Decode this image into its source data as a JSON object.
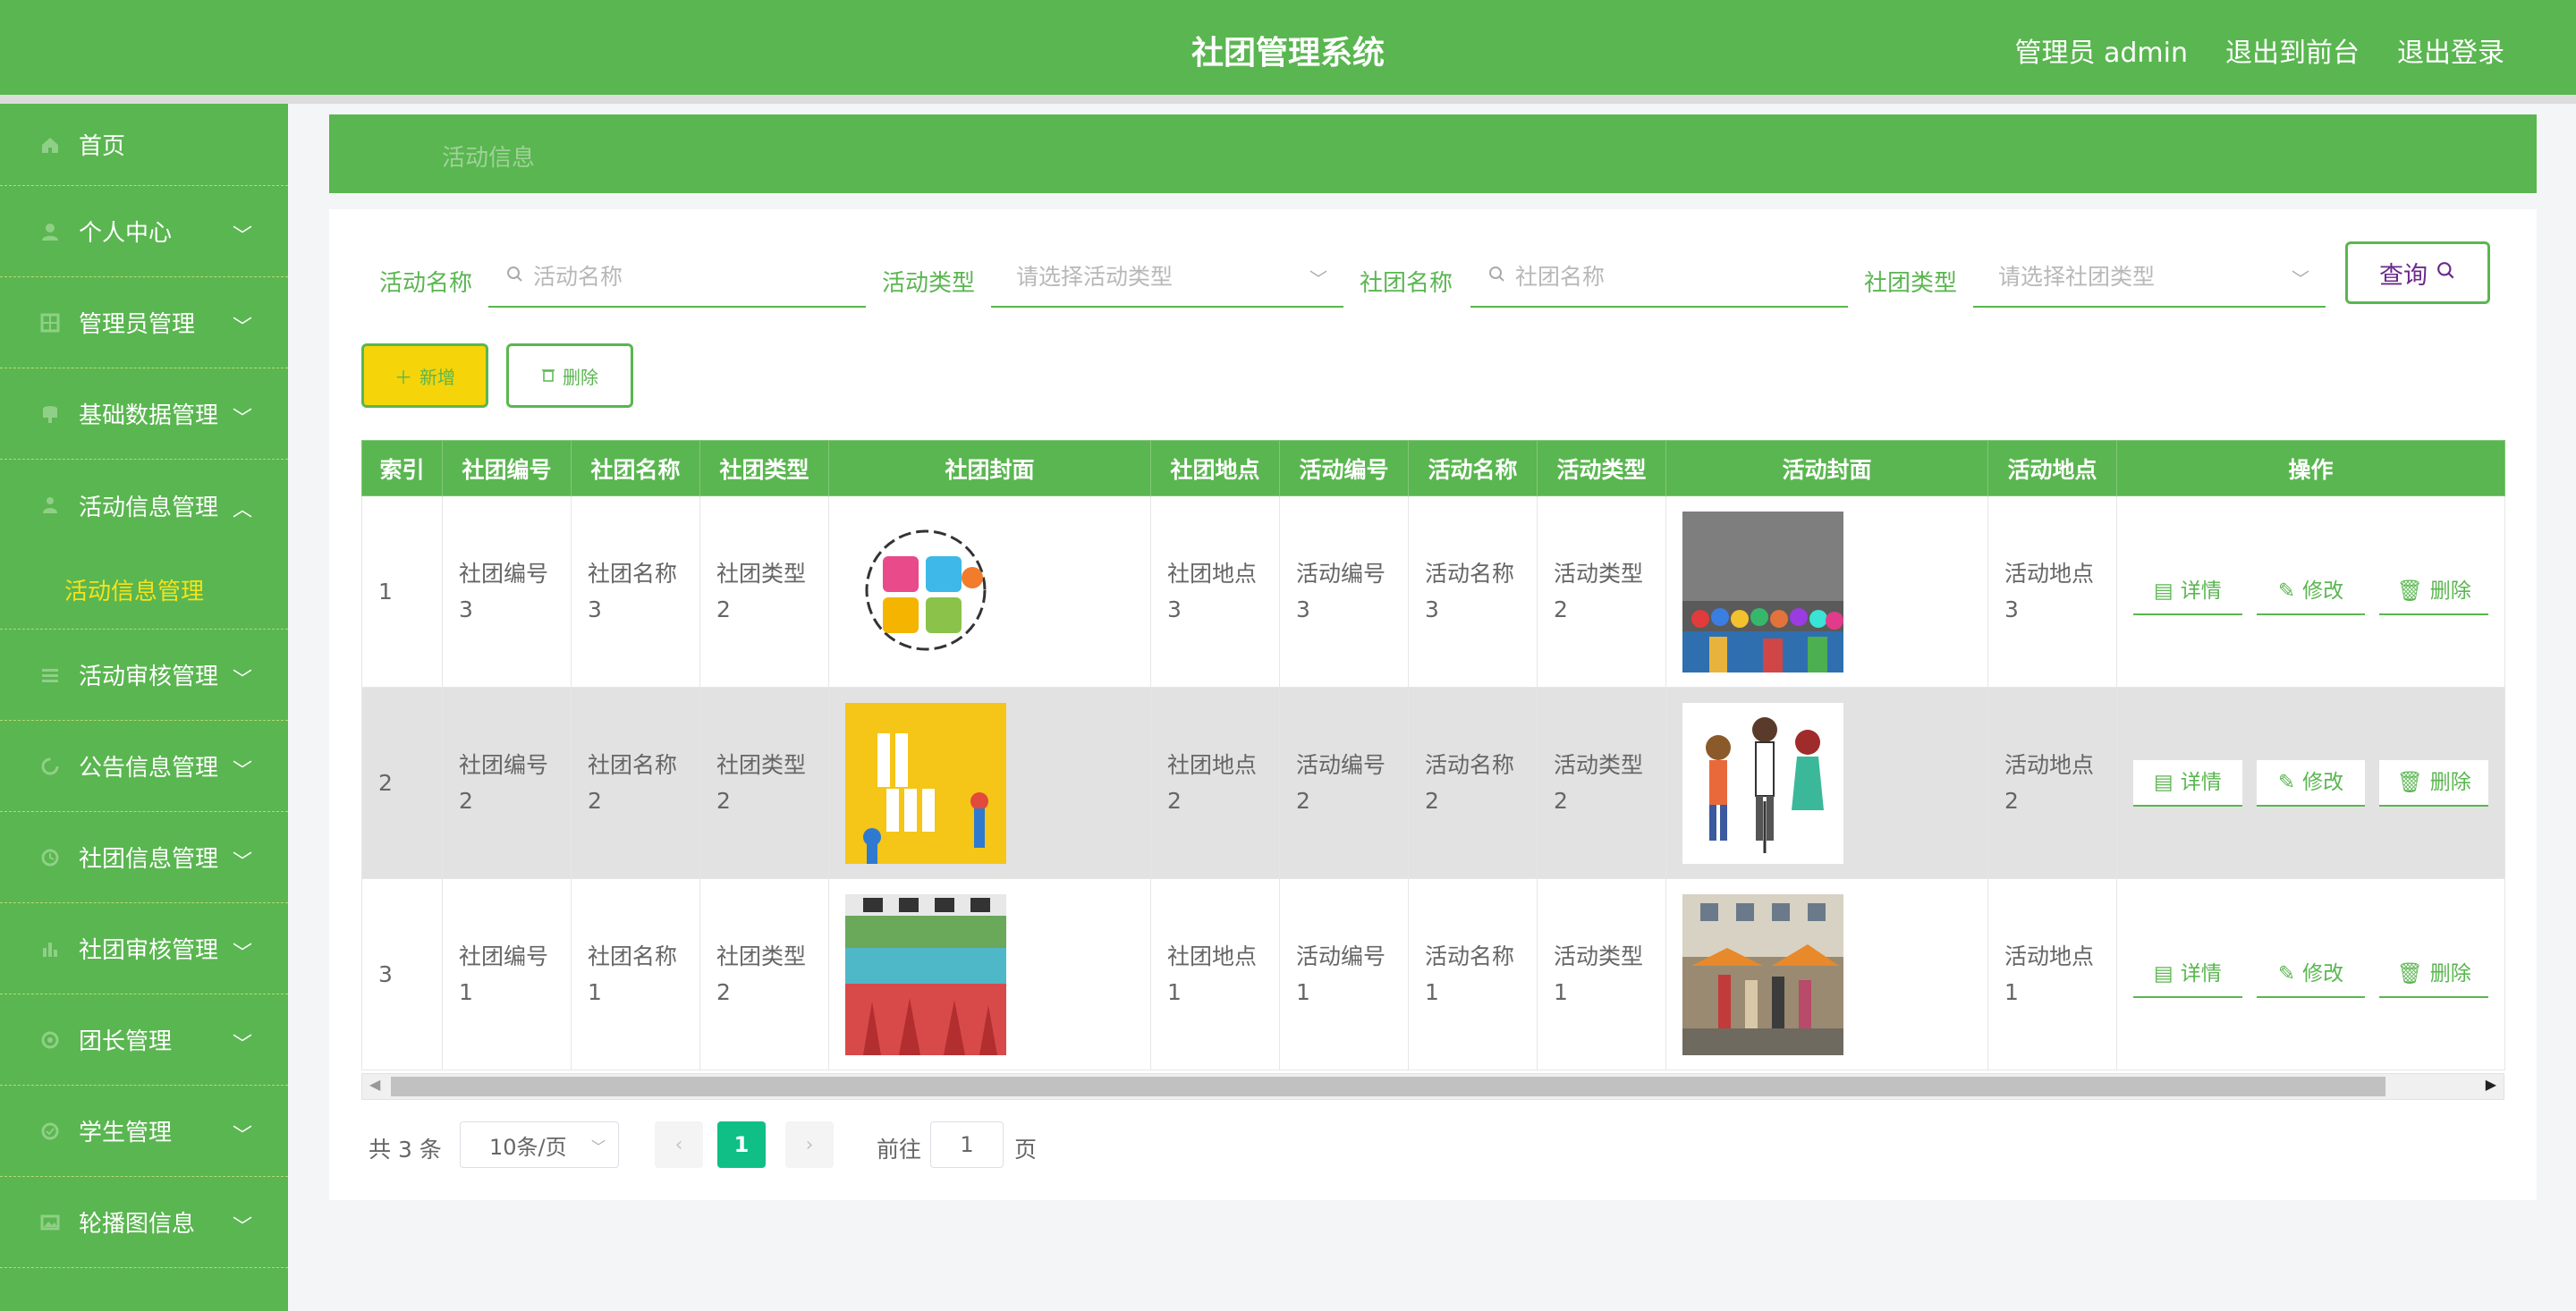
{
  "header": {
    "title": "社团管理系统",
    "admin_label": "管理员 admin",
    "front_link": "退出到前台",
    "logout_link": "退出登录"
  },
  "sidebar": {
    "items": [
      {
        "label": "首页",
        "icon": "home-icon"
      },
      {
        "label": "个人中心",
        "icon": "user-icon"
      },
      {
        "label": "管理员管理",
        "icon": "grid-icon"
      },
      {
        "label": "基础数据管理",
        "icon": "database-icon"
      },
      {
        "label": "活动信息管理",
        "icon": "person-icon",
        "expanded": true
      },
      {
        "label": "活动审核管理",
        "icon": "list-icon"
      },
      {
        "label": "公告信息管理",
        "icon": "refresh-icon"
      },
      {
        "label": "社团信息管理",
        "icon": "clock-icon"
      },
      {
        "label": "社团审核管理",
        "icon": "bar-chart-icon"
      },
      {
        "label": "团长管理",
        "icon": "circle-icon"
      },
      {
        "label": "学生管理",
        "icon": "check-icon"
      },
      {
        "label": "轮播图信息",
        "icon": "image-icon"
      }
    ],
    "active_sub": "活动信息管理"
  },
  "breadcrumb": "活动信息",
  "search": {
    "activity_name_label": "活动名称",
    "activity_name_placeholder": "活动名称",
    "activity_type_label": "活动类型",
    "activity_type_placeholder": "请选择活动类型",
    "club_name_label": "社团名称",
    "club_name_placeholder": "社团名称",
    "club_type_label": "社团类型",
    "club_type_placeholder": "请选择社团类型",
    "query_label": "查询"
  },
  "actions": {
    "add_label": "新增",
    "delete_label": "删除"
  },
  "table": {
    "headers": [
      "索引",
      "社团编号",
      "社团名称",
      "社团类型",
      "社团封面",
      "社团地点",
      "活动编号",
      "活动名称",
      "活动类型",
      "活动封面",
      "活动地点",
      "操作"
    ],
    "rows": [
      {
        "index": "1",
        "club_no": "社团编号3",
        "club_name": "社团名称3",
        "club_type": "社团类型2",
        "club_cover": "招新 poster (logo style)",
        "club_place": "社团地点3",
        "act_no": "活动编号3",
        "act_name": "活动名称3",
        "act_type": "活动类型2",
        "act_cover": "crowd photo",
        "act_place": "活动地点3"
      },
      {
        "index": "2",
        "club_no": "社团编号2",
        "club_name": "社团名称2",
        "club_type": "社团类型2",
        "club_cover": "社团大招新 poster",
        "club_place": "社团地点2",
        "act_no": "活动编号2",
        "act_name": "活动名称2",
        "act_type": "活动类型2",
        "act_cover": "singers cartoon",
        "act_place": "活动地点2"
      },
      {
        "index": "3",
        "club_no": "社团编号1",
        "club_name": "社团名称1",
        "club_type": "社团类型2",
        "club_cover": "社团招新 photo",
        "club_place": "社团地点1",
        "act_no": "活动编号1",
        "act_name": "活动名称1",
        "act_type": "活动类型1",
        "act_cover": "fair photo",
        "act_place": "活动地点1"
      }
    ],
    "op_detail": "详情",
    "op_edit": "修改",
    "op_delete": "删除"
  },
  "pagination": {
    "total": "共 3 条",
    "page_size": "10条/页",
    "current": "1",
    "goto_label": "前往",
    "goto_value": "1",
    "page_suffix": "页"
  },
  "colors": {
    "primary": "#5ab650",
    "accent_yellow": "#f5d40a",
    "page_active": "#0fbf86"
  }
}
